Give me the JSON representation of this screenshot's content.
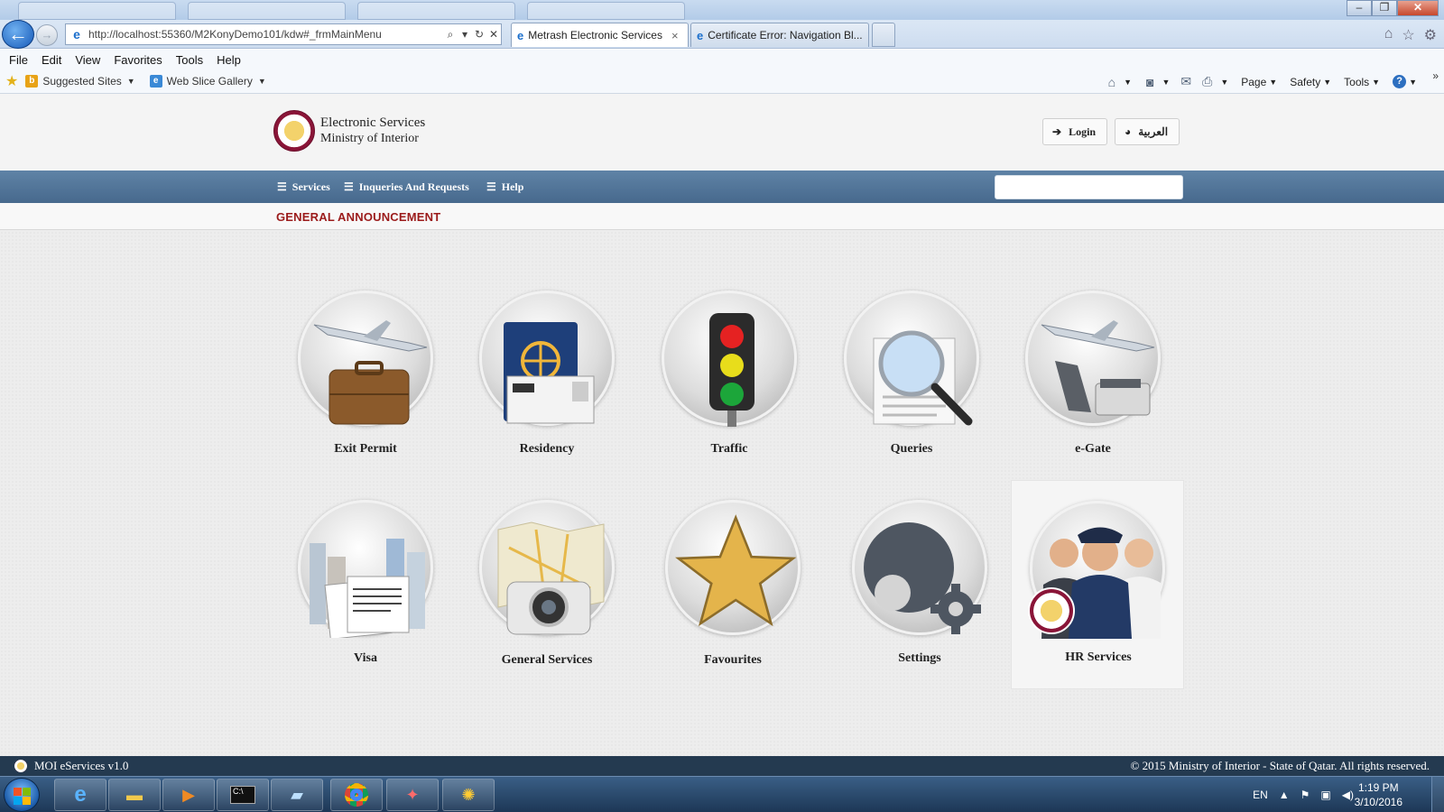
{
  "browser": {
    "address_url": "http://localhost:55360/M2KonyDemo101/kdw#_frmMainMenu",
    "tabs": [
      {
        "label": "Metrash Electronic Services",
        "close": "×"
      },
      {
        "label": "Certificate Error: Navigation Bl..."
      }
    ],
    "menu": [
      "File",
      "Edit",
      "View",
      "Favorites",
      "Tools",
      "Help"
    ],
    "favorites": [
      "Suggested Sites",
      "Web Slice Gallery"
    ],
    "commands": [
      "Page",
      "Safety",
      "Tools"
    ]
  },
  "site": {
    "logo_title": "Electronic Services",
    "logo_subtitle": "Ministry of Interior",
    "login_label": "Login",
    "language_label": "العربية",
    "nav": [
      "Services",
      "Inqueries And Requests",
      "Help"
    ],
    "announcement_title": "GENERAL ANNOUNCEMENT",
    "services": [
      {
        "label": "Exit Permit",
        "icon": "plane-briefcase-icon"
      },
      {
        "label": "Residency",
        "icon": "passport-icon"
      },
      {
        "label": "Traffic",
        "icon": "traffic-light-icon"
      },
      {
        "label": "Queries",
        "icon": "magnifier-icon"
      },
      {
        "label": "e-Gate",
        "icon": "plane-gate-icon"
      },
      {
        "label": "Visa",
        "icon": "city-visa-icon"
      },
      {
        "label": "General Services",
        "icon": "map-camera-icon"
      },
      {
        "label": "Favourites",
        "icon": "star-icon"
      },
      {
        "label": "Settings",
        "icon": "gear-icon"
      },
      {
        "label": "HR Services",
        "icon": "officers-icon"
      }
    ]
  },
  "status": {
    "version": "MOI eServices v1.0",
    "copyright": "© 2015 Ministry of Interior - State of Qatar. All rights reserved."
  },
  "taskbar": {
    "language": "EN",
    "time": "1:19 PM",
    "date": "3/10/2016"
  },
  "colors": {
    "nav_strip": "#4f7297",
    "announcement": "#9b1b1b",
    "footer": "#243a50",
    "maroon": "#8a1538"
  }
}
